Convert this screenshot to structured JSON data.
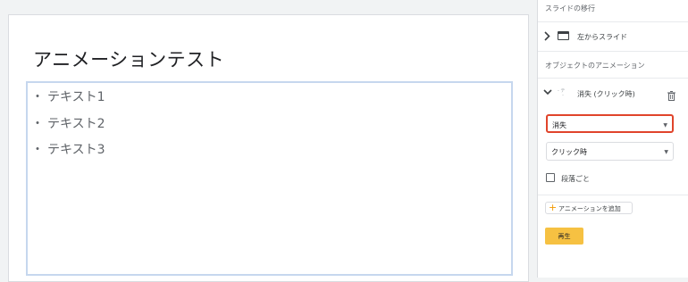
{
  "slide": {
    "title": "アニメーションテスト",
    "bullets": [
      "テキスト1",
      "テキスト2",
      "テキスト3"
    ],
    "bullet_marker": "・"
  },
  "panel": {
    "transition_header": "スライドの移行",
    "transition_value": "左からスライド",
    "object_anim_header": "オブジェクトのアニメーション",
    "anim_item_icon": "アニメーションアイコン",
    "anim_item_label": "消失 (クリック時)",
    "effect_select": "消失",
    "trigger_select": "クリック時",
    "by_paragraph_label": "段落ごと",
    "by_paragraph_checked": false,
    "add_animation_label": "アニメーションを追加",
    "play_label": "再生"
  },
  "colors": {
    "highlight": "#e0442b",
    "play_button": "#f6c142",
    "add_plus": "#f29900",
    "textbox_border": "#c6d7ee"
  },
  "icons": [
    "chevron-right-icon",
    "slide-icon",
    "chevron-down-icon",
    "animation-icon",
    "trash-icon",
    "dropdown-arrow-icon",
    "checkbox-icon",
    "plus-icon"
  ]
}
